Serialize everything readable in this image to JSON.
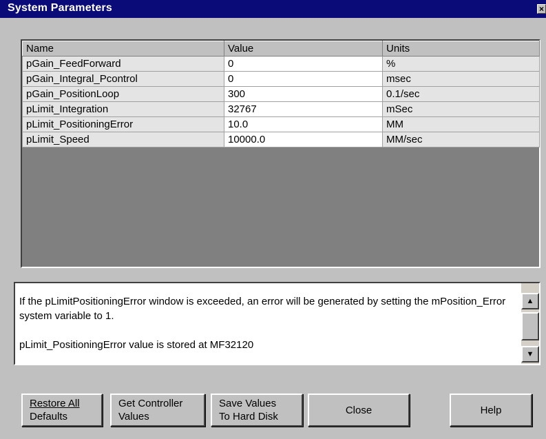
{
  "window": {
    "title": "System Parameters",
    "close_glyph": "×"
  },
  "grid": {
    "columns": [
      "Name",
      "Value",
      "Units"
    ],
    "rows": [
      {
        "name": "pGain_FeedForward",
        "value": "0",
        "units": "%"
      },
      {
        "name": "pGain_Integral_Pcontrol",
        "value": "0",
        "units": "msec"
      },
      {
        "name": "pGain_PositionLoop",
        "value": "300",
        "units": "0.1/sec"
      },
      {
        "name": "pLimit_Integration",
        "value": "32767",
        "units": "mSec"
      },
      {
        "name": "pLimit_PositioningError",
        "value": "10.0",
        "units": "MM"
      },
      {
        "name": "pLimit_Speed",
        "value": "10000.0",
        "units": "MM/sec"
      }
    ]
  },
  "description": {
    "paragraph1": "If the pLimitPositioningError window is exceeded, an error will be generated by setting the mPosition_Error system variable to 1.",
    "paragraph2": "pLimit_PositioningError value is stored at MF32120"
  },
  "buttons": {
    "restore_line1": "Restore All",
    "restore_line2": "Defaults",
    "get_line1": "Get Controller",
    "get_line2": "Values",
    "save_line1": "Save Values",
    "save_line2": "To Hard Disk",
    "close": "Close",
    "help": "Help"
  },
  "icons": {
    "scroll_up": "up-arrow-icon",
    "scroll_down": "down-arrow-icon",
    "close": "close-icon"
  }
}
